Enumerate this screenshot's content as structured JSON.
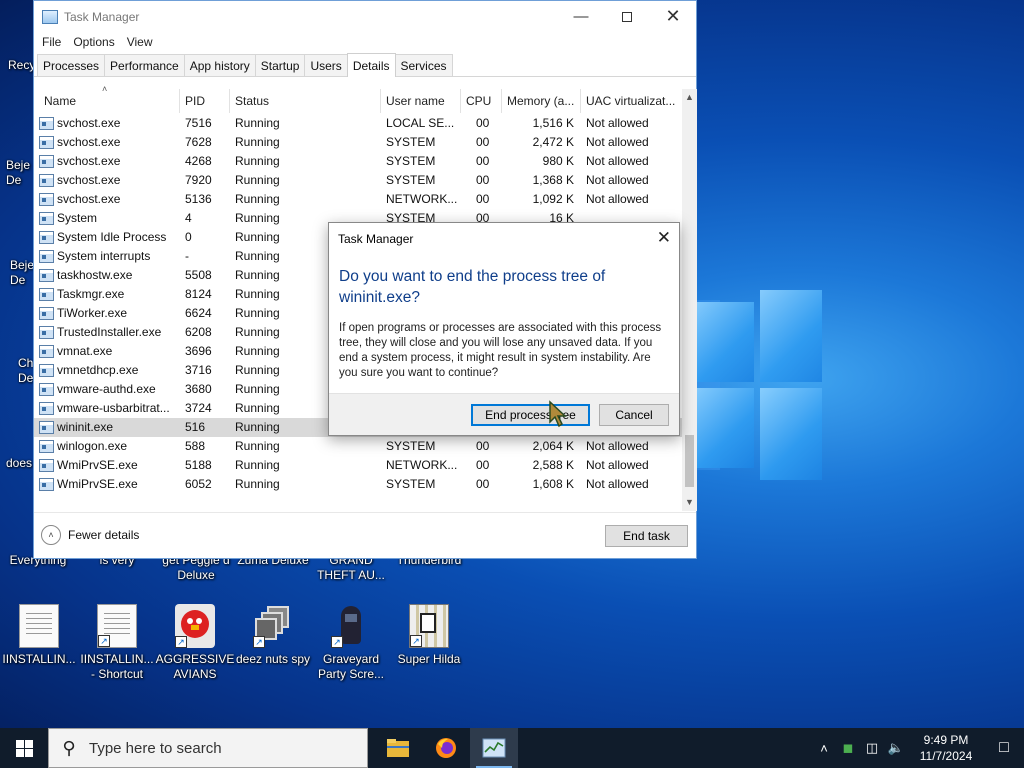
{
  "desktop": {
    "icons_row2": [
      {
        "label": "IINSTALLIN...",
        "type": "doc"
      },
      {
        "label": "IINSTALLIN... - Shortcut",
        "type": "doc"
      },
      {
        "label": "AGGRESSIVE AVIANS",
        "type": "bird"
      },
      {
        "label": "deez nuts spy",
        "type": "windows"
      },
      {
        "label": "Graveyard Party Scre...",
        "type": "ghost"
      },
      {
        "label": "Super Hilda",
        "type": "pixel"
      }
    ],
    "icons_row1_labels": [
      "Everything",
      "is very",
      "get Peggle d Deluxe",
      "Zuma Deluxe",
      "GRAND THEFT AU...",
      "Thunderbird"
    ],
    "left_edge_labels": [
      "Recy",
      "Beje De",
      "Beje De",
      "Ch De",
      "does"
    ]
  },
  "task_manager": {
    "title": "Task Manager",
    "menu": [
      "File",
      "Options",
      "View"
    ],
    "tabs": [
      "Processes",
      "Performance",
      "App history",
      "Startup",
      "Users",
      "Details",
      "Services"
    ],
    "active_tab": "Details",
    "columns": [
      "Name",
      "PID",
      "Status",
      "User name",
      "CPU",
      "Memory (a...",
      "UAC virtualizat..."
    ],
    "rows": [
      {
        "name": "svchost.exe",
        "pid": "7516",
        "status": "Running",
        "user": "LOCAL SE...",
        "cpu": "00",
        "mem": "1,516 K",
        "uac": "Not allowed"
      },
      {
        "name": "svchost.exe",
        "pid": "7628",
        "status": "Running",
        "user": "SYSTEM",
        "cpu": "00",
        "mem": "2,472 K",
        "uac": "Not allowed"
      },
      {
        "name": "svchost.exe",
        "pid": "4268",
        "status": "Running",
        "user": "SYSTEM",
        "cpu": "00",
        "mem": "980 K",
        "uac": "Not allowed"
      },
      {
        "name": "svchost.exe",
        "pid": "7920",
        "status": "Running",
        "user": "SYSTEM",
        "cpu": "00",
        "mem": "1,368 K",
        "uac": "Not allowed"
      },
      {
        "name": "svchost.exe",
        "pid": "5136",
        "status": "Running",
        "user": "NETWORK...",
        "cpu": "00",
        "mem": "1,092 K",
        "uac": "Not allowed"
      },
      {
        "name": "System",
        "pid": "4",
        "status": "Running",
        "user": "SYSTEM",
        "cpu": "00",
        "mem": "16 K",
        "uac": ""
      },
      {
        "name": "System Idle Process",
        "pid": "0",
        "status": "Running",
        "user": "",
        "cpu": "",
        "mem": "",
        "uac": ""
      },
      {
        "name": "System interrupts",
        "pid": "-",
        "status": "Running",
        "user": "",
        "cpu": "",
        "mem": "",
        "uac": ""
      },
      {
        "name": "taskhostw.exe",
        "pid": "5508",
        "status": "Running",
        "user": "",
        "cpu": "",
        "mem": "",
        "uac": ""
      },
      {
        "name": "Taskmgr.exe",
        "pid": "8124",
        "status": "Running",
        "user": "",
        "cpu": "",
        "mem": "",
        "uac": ""
      },
      {
        "name": "TiWorker.exe",
        "pid": "6624",
        "status": "Running",
        "user": "",
        "cpu": "",
        "mem": "",
        "uac": ""
      },
      {
        "name": "TrustedInstaller.exe",
        "pid": "6208",
        "status": "Running",
        "user": "",
        "cpu": "",
        "mem": "",
        "uac": ""
      },
      {
        "name": "vmnat.exe",
        "pid": "3696",
        "status": "Running",
        "user": "",
        "cpu": "",
        "mem": "",
        "uac": ""
      },
      {
        "name": "vmnetdhcp.exe",
        "pid": "3716",
        "status": "Running",
        "user": "",
        "cpu": "",
        "mem": "",
        "uac": ""
      },
      {
        "name": "vmware-authd.exe",
        "pid": "3680",
        "status": "Running",
        "user": "",
        "cpu": "",
        "mem": "",
        "uac": ""
      },
      {
        "name": "vmware-usbarbitrat...",
        "pid": "3724",
        "status": "Running",
        "user": "",
        "cpu": "",
        "mem": "",
        "uac": ""
      },
      {
        "name": "wininit.exe",
        "pid": "516",
        "status": "Running",
        "user": "",
        "cpu": "",
        "mem": "",
        "uac": "",
        "selected": true
      },
      {
        "name": "winlogon.exe",
        "pid": "588",
        "status": "Running",
        "user": "SYSTEM",
        "cpu": "00",
        "mem": "2,064 K",
        "uac": "Not allowed"
      },
      {
        "name": "WmiPrvSE.exe",
        "pid": "5188",
        "status": "Running",
        "user": "NETWORK...",
        "cpu": "00",
        "mem": "2,588 K",
        "uac": "Not allowed"
      },
      {
        "name": "WmiPrvSE.exe",
        "pid": "6052",
        "status": "Running",
        "user": "SYSTEM",
        "cpu": "00",
        "mem": "1,608 K",
        "uac": "Not allowed"
      }
    ],
    "fewer_details": "Fewer details",
    "end_task": "End task"
  },
  "dialog": {
    "title": "Task Manager",
    "main_instruction": "Do you want to end the process tree of wininit.exe?",
    "body": "If open programs or processes are associated with this process tree, they will close and you will lose any unsaved data. If you end a system process, it might result in system instability. Are you sure you want to continue?",
    "confirm_button": "End process tree",
    "cancel_button": "Cancel"
  },
  "taskbar": {
    "search_placeholder": "Type here to search",
    "time": "9:49 PM",
    "date": "11/7/2024",
    "apps": [
      "file-explorer-icon",
      "firefox-icon",
      "task-manager-icon"
    ]
  }
}
